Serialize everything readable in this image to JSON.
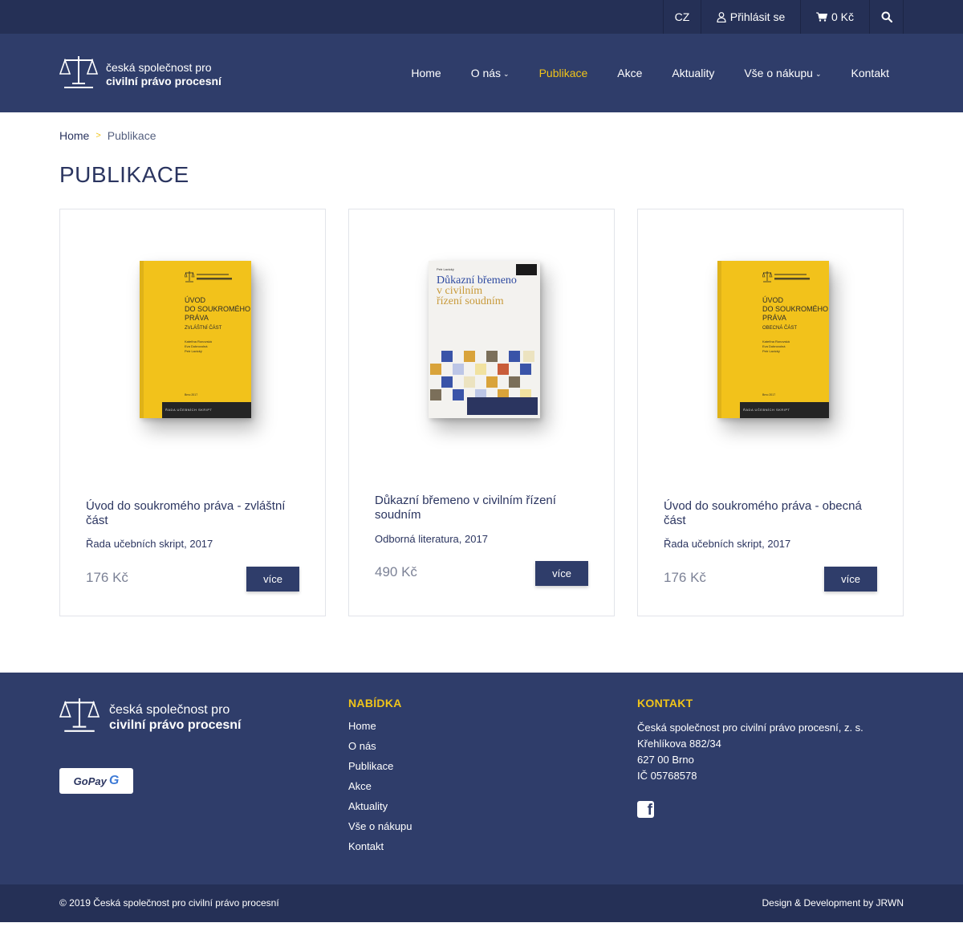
{
  "topbar": {
    "lang": "CZ",
    "login_label": "Přihlásit se",
    "cart_label": "0 Kč"
  },
  "brand": {
    "line1": "česká společnost pro",
    "line2": "civilní právo procesní"
  },
  "nav": {
    "items": [
      {
        "label": "Home"
      },
      {
        "label": "O nás"
      },
      {
        "label": "Publikace"
      },
      {
        "label": "Akce"
      },
      {
        "label": "Aktuality"
      },
      {
        "label": "Vše o nákupu"
      },
      {
        "label": "Kontakt"
      }
    ],
    "active": "Publikace"
  },
  "breadcrumb": {
    "home": "Home",
    "separator": ">",
    "current": "Publikace"
  },
  "page": {
    "title": "PUBLIKACE"
  },
  "products": [
    {
      "title": "Úvod do soukromého práva - zvláštní část",
      "meta": "Řada učebních skript, 2017",
      "price": "176 Kč",
      "button": "více",
      "cover": {
        "title_lines": "ÚVOD\nDO SOUKROMÉHO\nPRÁVA",
        "subtitle": "ZVLÁŠTNÍ ČÁST",
        "authors": "Kateřina Ronovská\nEva Dobrovolná\nPetr Lavický",
        "year": "Brno 2017",
        "series": "ŘADA UČEBNÍCH SKRIPT"
      }
    },
    {
      "title": "Důkazní břemeno v civilním řízení soudním",
      "meta": "Odborná literatura, 2017",
      "price": "490 Kč",
      "button": "více",
      "cover": {
        "author": "Petr Lavický",
        "title_line1": "Důkazní břemeno",
        "title_line2": "v civilním",
        "title_line3": "řízení soudním"
      }
    },
    {
      "title": "Úvod do soukromého práva - obecná část",
      "meta": "Řada učebních skript, 2017",
      "price": "176 Kč",
      "button": "více",
      "cover": {
        "title_lines": "ÚVOD\nDO SOUKROMÉHO\nPRÁVA",
        "subtitle": "OBECNÁ ČÁST",
        "authors": "Kateřina Ronovská\nEva Dobrovolná\nPetr Lavický",
        "year": "Brno 2017",
        "series": "ŘADA UČEBNÍCH SKRIPT"
      }
    }
  ],
  "footer": {
    "gopay_text": "GoPay",
    "gopay_mark": "G",
    "menu_heading": "NABÍDKA",
    "menu": [
      "Home",
      "O nás",
      "Publikace",
      "Akce",
      "Aktuality",
      "Vše o nákupu",
      "Kontakt"
    ],
    "contact_heading": "KONTAKT",
    "contact": {
      "org": "Česká společnost pro civilní právo procesní, z. s.",
      "street": "Křehlíkova 882/34",
      "city": "627 00 Brno",
      "ic": "IČ 05768578"
    },
    "facebook_glyph": "f"
  },
  "bottom": {
    "copyright": "© 2019 Česká společnost pro civilní právo procesní",
    "credit": "Design & Development by JRWN"
  },
  "colors": {
    "navy": "#2f3d6a",
    "navy_dark": "#253056",
    "accent": "#f0c419",
    "book_yellow": "#f2c21b"
  },
  "icons": [
    "user-icon",
    "cart-icon",
    "search-icon",
    "scales-logo-icon",
    "facebook-icon",
    "chevron-down-icon"
  ]
}
